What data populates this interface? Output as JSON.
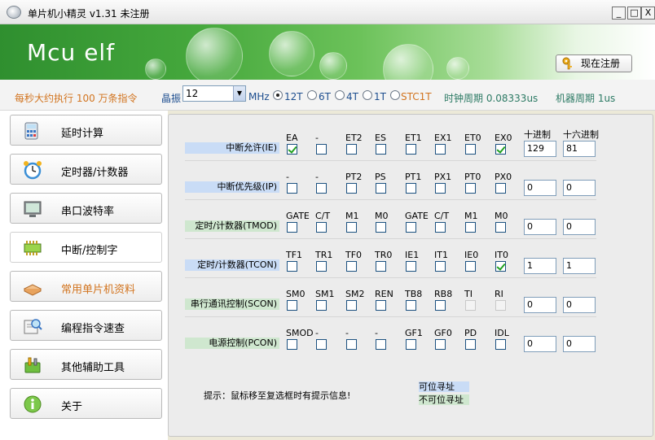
{
  "window": {
    "title": "单片机小精灵 v1.31 未注册",
    "min": "_",
    "max": "□",
    "close": "X"
  },
  "banner": {
    "brand": "Mcu elf",
    "register_label": "现在注册"
  },
  "infobar": {
    "speed_text": "每秒大约执行 100 万条指令",
    "crystal_label": "晶振",
    "crystal_value": "12",
    "unit": "MHz",
    "modes": [
      "12T",
      "6T",
      "4T",
      "1T",
      "STC1T"
    ],
    "selected_mode": "12T",
    "clock_period": "时钟周期 0.08333us",
    "machine_period": "机器周期 1us"
  },
  "sidebar": {
    "items": [
      {
        "label": "延时计算",
        "icon": "calculator-icon"
      },
      {
        "label": "定时器/计数器",
        "icon": "alarm-clock-icon"
      },
      {
        "label": "串口波特率",
        "icon": "monitor-icon"
      },
      {
        "label": "中断/控制字",
        "icon": "chip-icon"
      },
      {
        "label": "常用单片机资料",
        "icon": "book-icon"
      },
      {
        "label": "编程指令速查",
        "icon": "search-book-icon"
      },
      {
        "label": "其他辅助工具",
        "icon": "tools-icon"
      },
      {
        "label": "关于",
        "icon": "info-icon"
      }
    ],
    "active_index": 3,
    "highlight_index": 4
  },
  "columns": {
    "decimal": "十进制",
    "hex": "十六进制"
  },
  "registers": [
    {
      "label": "中断允许(IE)",
      "bits": [
        "EA",
        "-",
        "ET2",
        "ES",
        "ET1",
        "EX1",
        "ET0",
        "EX0"
      ],
      "checked": [
        0,
        7
      ],
      "disabled": [],
      "dec": "129",
      "hex": "81"
    },
    {
      "label": "中断优先级(IP)",
      "bits": [
        "-",
        "-",
        "PT2",
        "PS",
        "PT1",
        "PX1",
        "PT0",
        "PX0"
      ],
      "checked": [],
      "disabled": [],
      "dec": "0",
      "hex": "0"
    },
    {
      "label": "定时/计数器(TMOD)",
      "bits": [
        "GATE",
        "C/T",
        "M1",
        "M0",
        "GATE",
        "C/T",
        "M1",
        "M0"
      ],
      "checked": [],
      "disabled": [],
      "dec": "0",
      "hex": "0"
    },
    {
      "label": "定时/计数器(TCON)",
      "bits": [
        "TF1",
        "TR1",
        "TF0",
        "TR0",
        "IE1",
        "IT1",
        "IE0",
        "IT0"
      ],
      "checked": [
        7
      ],
      "disabled": [],
      "dec": "1",
      "hex": "1"
    },
    {
      "label": "串行通讯控制(SCON)",
      "bits": [
        "SM0",
        "SM1",
        "SM2",
        "REN",
        "TB8",
        "RB8",
        "TI",
        "RI"
      ],
      "checked": [],
      "disabled": [
        6,
        7
      ],
      "dec": "0",
      "hex": "0"
    },
    {
      "label": "电源控制(PCON)",
      "bits": [
        "SMOD",
        "-",
        "-",
        "-",
        "GF1",
        "GF0",
        "PD",
        "IDL"
      ],
      "checked": [],
      "disabled": [],
      "dec": "0",
      "hex": "0"
    }
  ],
  "hint": "提示：鼠标移至复选框时有提示信息!",
  "legend": {
    "bit_addressable": "可位寻址",
    "not_bit_addressable": "不可位寻址",
    "bit_color": "#c9dcf6",
    "nonbit_color": "#cfe7cf"
  }
}
